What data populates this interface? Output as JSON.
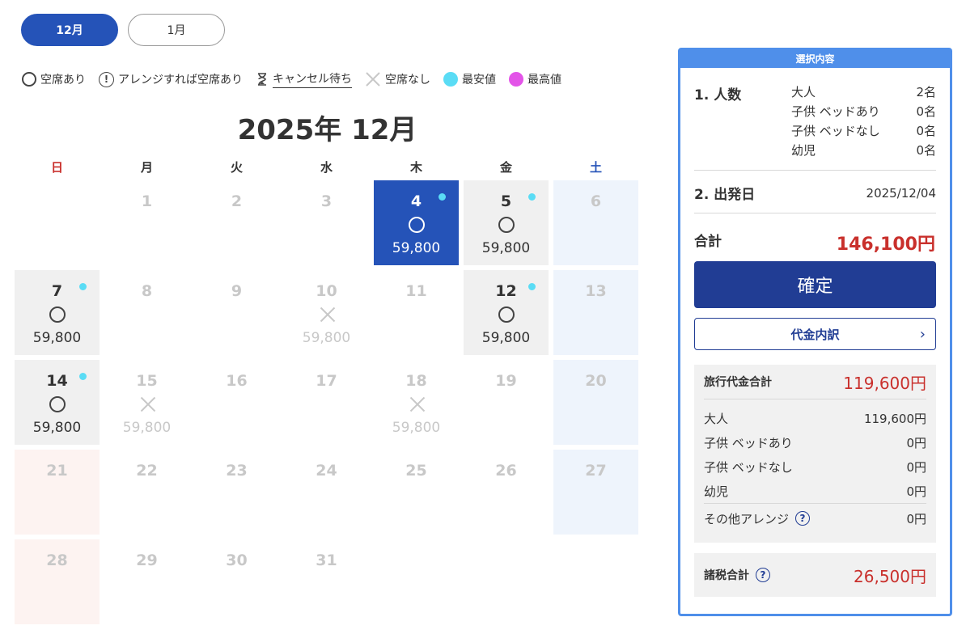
{
  "tabs": [
    {
      "label": "12月",
      "active": true
    },
    {
      "label": "1月",
      "active": false
    }
  ],
  "legend": {
    "available": "空席あり",
    "arrange": "アレンジすれば空席あり",
    "cancel_wait": "キャンセル待ち",
    "full": "空席なし",
    "lowest": "最安値",
    "highest": "最高値",
    "lowest_color": "#5adcf5",
    "highest_color": "#e354e8"
  },
  "calendar": {
    "title": "2025年 12月",
    "weekdays": [
      "日",
      "月",
      "火",
      "水",
      "木",
      "金",
      "土"
    ],
    "start_offset": 1,
    "days": [
      {
        "d": "1"
      },
      {
        "d": "2"
      },
      {
        "d": "3"
      },
      {
        "d": "4",
        "status": "available",
        "price": "59,800",
        "cheap": true,
        "selected": true
      },
      {
        "d": "5",
        "status": "available",
        "price": "59,800",
        "cheap": true
      },
      {
        "d": "6"
      },
      {
        "d": "7",
        "status": "available",
        "price": "59,800",
        "cheap": true
      },
      {
        "d": "8"
      },
      {
        "d": "9"
      },
      {
        "d": "10",
        "status": "full",
        "price": "59,800"
      },
      {
        "d": "11"
      },
      {
        "d": "12",
        "status": "available",
        "price": "59,800",
        "cheap": true
      },
      {
        "d": "13"
      },
      {
        "d": "14",
        "status": "available",
        "price": "59,800",
        "cheap": true
      },
      {
        "d": "15",
        "status": "full",
        "price": "59,800"
      },
      {
        "d": "16"
      },
      {
        "d": "17"
      },
      {
        "d": "18",
        "status": "full",
        "price": "59,800"
      },
      {
        "d": "19"
      },
      {
        "d": "20"
      },
      {
        "d": "21"
      },
      {
        "d": "22"
      },
      {
        "d": "23"
      },
      {
        "d": "24"
      },
      {
        "d": "25"
      },
      {
        "d": "26"
      },
      {
        "d": "27"
      },
      {
        "d": "28"
      },
      {
        "d": "29"
      },
      {
        "d": "30"
      },
      {
        "d": "31"
      }
    ]
  },
  "panel": {
    "header": "選択内容",
    "people_title": "1. 人数",
    "people": [
      {
        "label": "大人",
        "value": "2名"
      },
      {
        "label": "子供 ベッドあり",
        "value": "0名"
      },
      {
        "label": "子供 ベッドなし",
        "value": "0名"
      },
      {
        "label": "幼児",
        "value": "0名"
      }
    ],
    "date_title": "2. 出発日",
    "date_value": "2025/12/04",
    "total_label": "合計",
    "total_value": "146,100円",
    "confirm_label": "確定",
    "breakdown_label": "代金内訳",
    "travel_total_label": "旅行代金合計",
    "travel_total_value": "119,600円",
    "travel_rows": [
      {
        "label": "大人",
        "value": "119,600円"
      },
      {
        "label": "子供 ベッドあり",
        "value": "0円"
      },
      {
        "label": "子供 ベッドなし",
        "value": "0円"
      },
      {
        "label": "幼児",
        "value": "0円"
      }
    ],
    "other_label": "その他アレンジ",
    "other_value": "0円",
    "tax_label": "諸税合計",
    "tax_value": "26,500円"
  }
}
